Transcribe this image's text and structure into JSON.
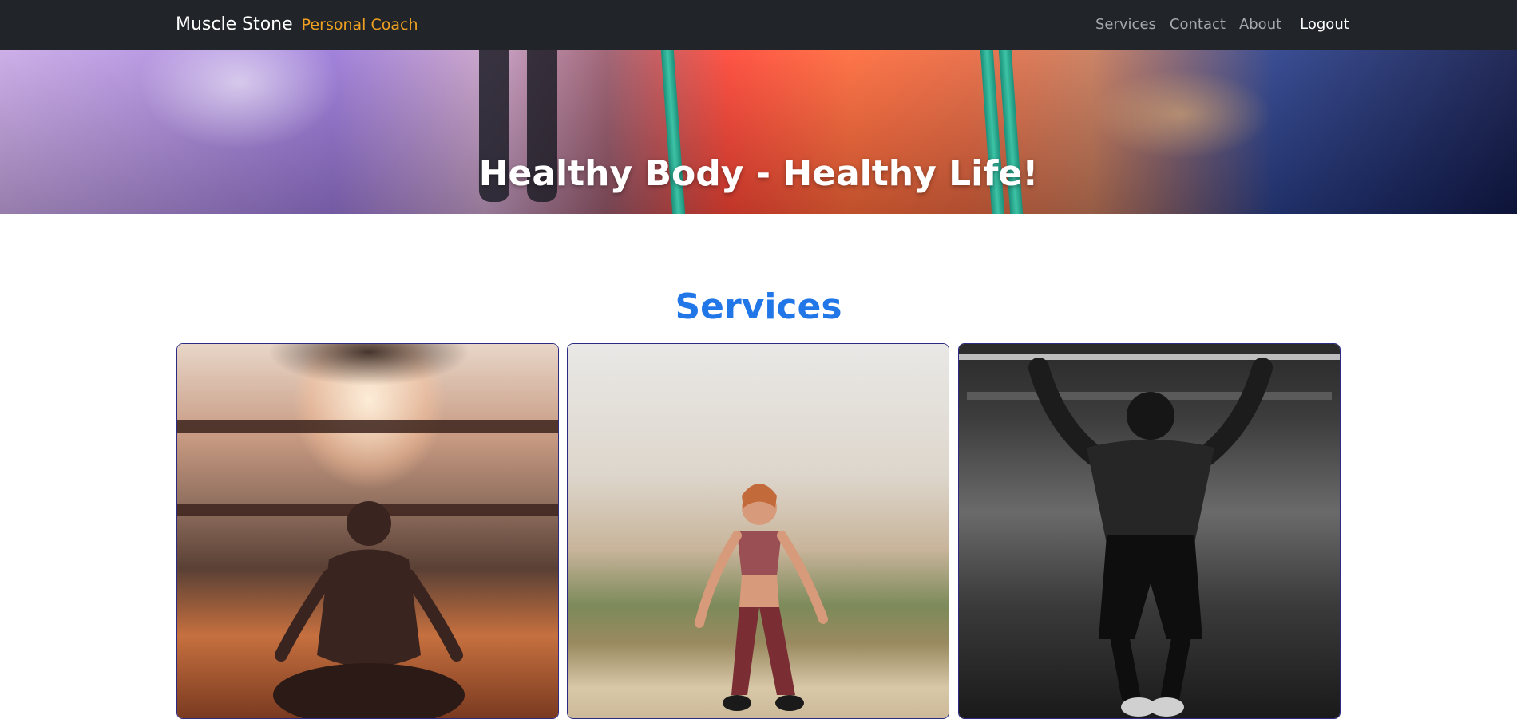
{
  "navbar": {
    "brand": "Muscle Stone",
    "brand_sub": "Personal Coach",
    "links": [
      "Services",
      "Contact",
      "About"
    ],
    "logout": "Logout"
  },
  "hero": {
    "title": "Healthy Body - Healthy Life!",
    "slides": 3,
    "active_slide": 1
  },
  "services": {
    "title": "Services",
    "cards": [
      {
        "image": "meditation-sunset-photo"
      },
      {
        "image": "woman-jumping-training-photo"
      },
      {
        "image": "man-pull-ups-photo"
      }
    ]
  },
  "colors": {
    "navbar_bg": "#212529",
    "brand_accent": "#f0a020",
    "section_title": "#2176e8",
    "card_border": "#2b2b86"
  }
}
